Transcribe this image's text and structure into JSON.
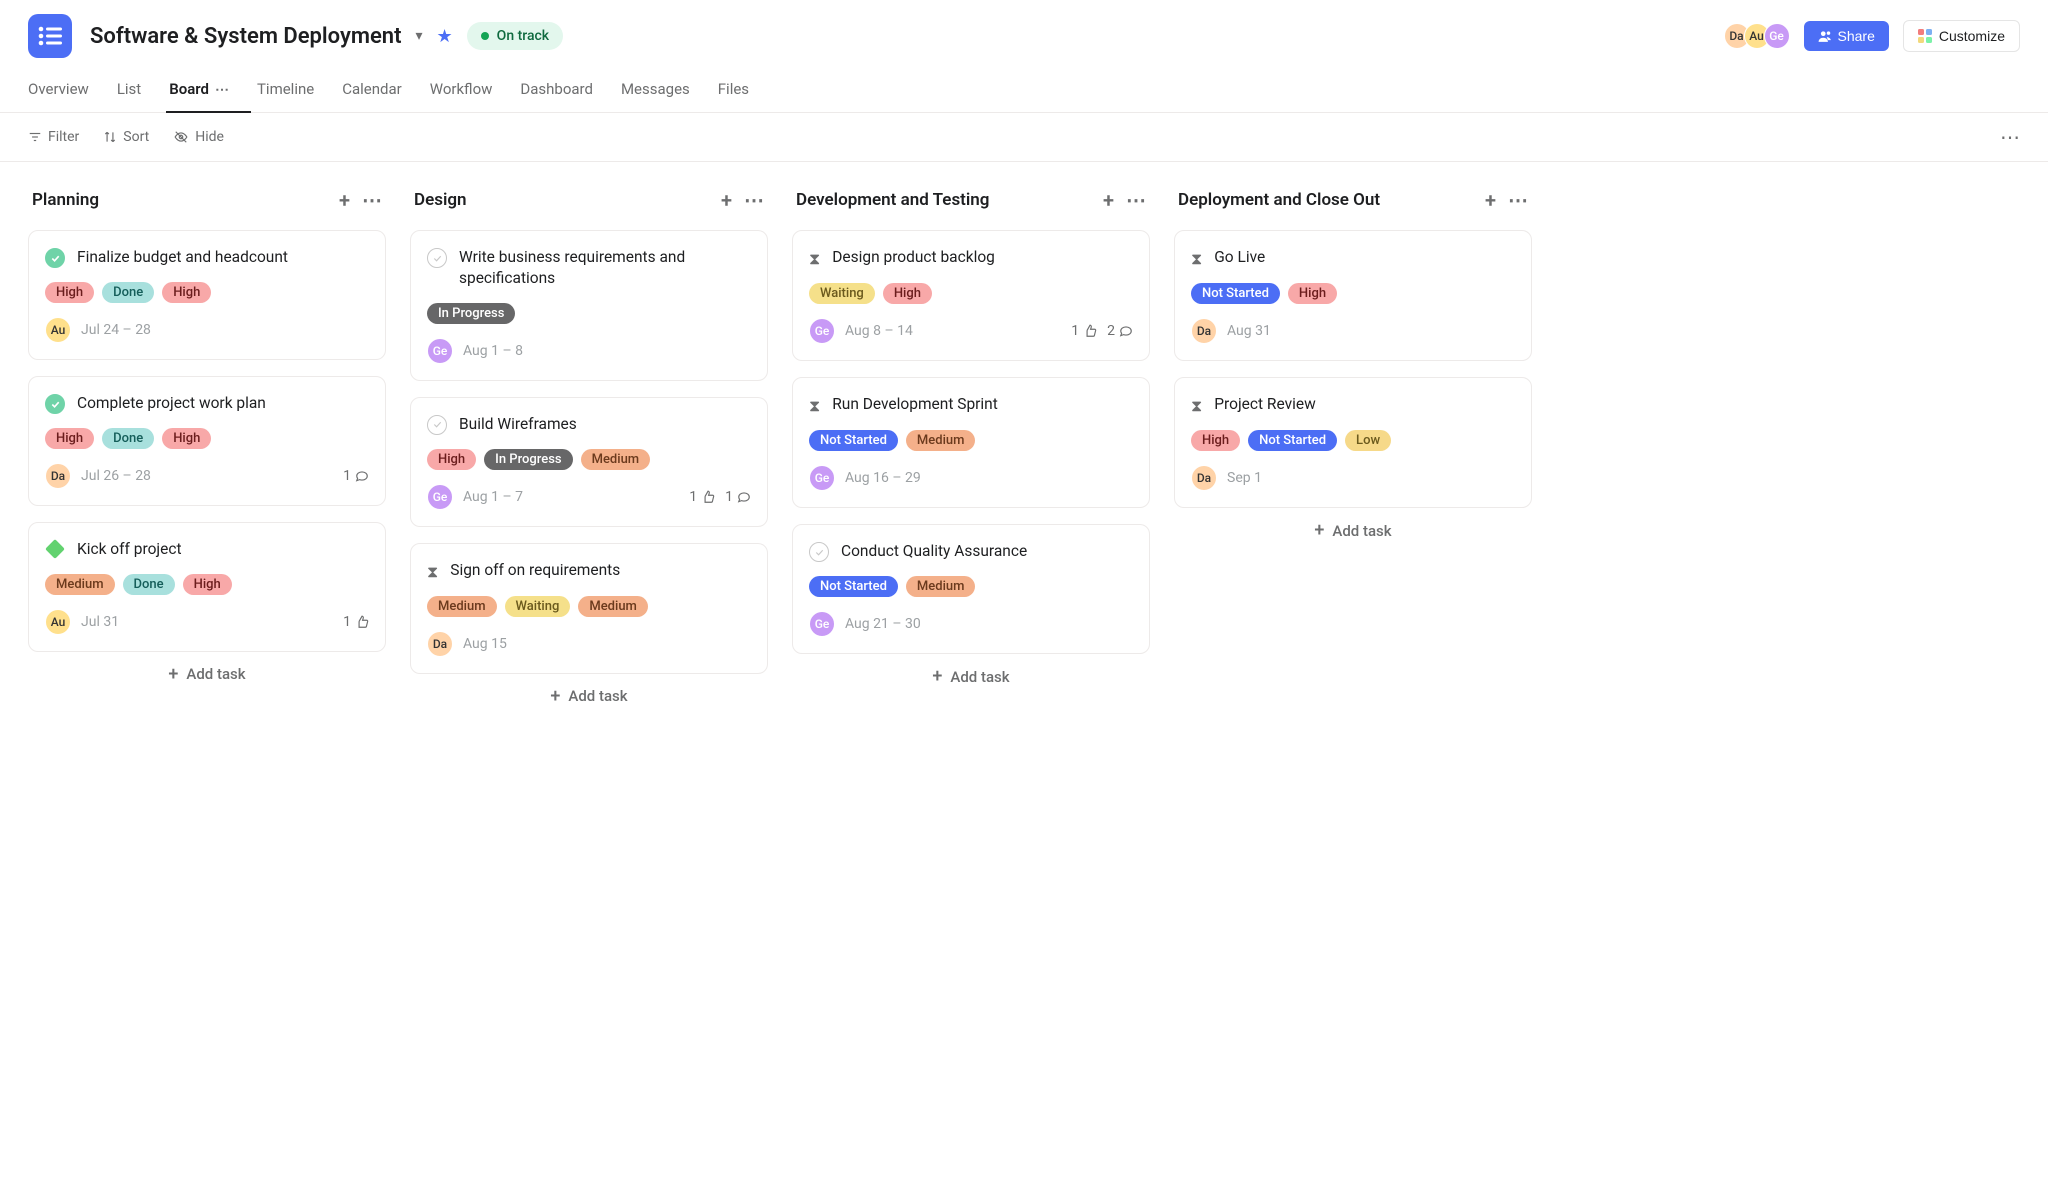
{
  "project": {
    "title": "Software & System Deployment",
    "status": "On track"
  },
  "header": {
    "share_label": "Share",
    "customize_label": "Customize",
    "members": [
      "Da",
      "Au",
      "Ge"
    ]
  },
  "tabs": [
    {
      "label": "Overview"
    },
    {
      "label": "List"
    },
    {
      "label": "Board",
      "active": true
    },
    {
      "label": "Timeline"
    },
    {
      "label": "Calendar"
    },
    {
      "label": "Workflow"
    },
    {
      "label": "Dashboard"
    },
    {
      "label": "Messages"
    },
    {
      "label": "Files"
    }
  ],
  "toolbar": {
    "filter": "Filter",
    "sort": "Sort",
    "hide": "Hide"
  },
  "add_task_label": "Add task",
  "columns": [
    {
      "title": "Planning",
      "cards": [
        {
          "icon": "check-done",
          "title": "Finalize budget and headcount",
          "tags": [
            "High",
            "Done",
            "High"
          ],
          "assignee": "Au",
          "date": "Jul 24 – 28"
        },
        {
          "icon": "check-done",
          "title": "Complete project work plan",
          "tags": [
            "High",
            "Done",
            "High"
          ],
          "assignee": "Da",
          "date": "Jul 26 – 28",
          "comments": 1
        },
        {
          "icon": "milestone",
          "title": "Kick off project",
          "tags": [
            "Medium",
            "Done",
            "High"
          ],
          "assignee": "Au",
          "date": "Jul 31",
          "likes": 1
        }
      ]
    },
    {
      "title": "Design",
      "cards": [
        {
          "icon": "check",
          "title": "Write business requirements and specifications",
          "tags": [
            "In Progress"
          ],
          "assignee": "Ge",
          "date": "Aug 1 – 8"
        },
        {
          "icon": "check",
          "title": "Build Wireframes",
          "tags": [
            "High",
            "In Progress",
            "Medium"
          ],
          "assignee": "Ge",
          "date": "Aug 1 – 7",
          "likes": 1,
          "comments": 1
        },
        {
          "icon": "hourglass",
          "title": "Sign off on requirements",
          "tags": [
            "Medium",
            "Waiting",
            "Medium"
          ],
          "assignee": "Da",
          "date": "Aug 15"
        }
      ]
    },
    {
      "title": "Development and Testing",
      "cards": [
        {
          "icon": "hourglass",
          "title": "Design product backlog",
          "tags": [
            "Waiting",
            "High"
          ],
          "assignee": "Ge",
          "date": "Aug 8 – 14",
          "likes": 1,
          "comments": 2
        },
        {
          "icon": "hourglass",
          "title": "Run Development Sprint",
          "tags": [
            "Not Started",
            "Medium"
          ],
          "assignee": "Ge",
          "date": "Aug 16 – 29"
        },
        {
          "icon": "check",
          "title": "Conduct Quality Assurance",
          "tags": [
            "Not Started",
            "Medium"
          ],
          "assignee": "Ge",
          "date": "Aug 21 – 30"
        }
      ]
    },
    {
      "title": "Deployment and Close Out",
      "cards": [
        {
          "icon": "hourglass",
          "title": "Go Live",
          "tags": [
            "Not Started",
            "High"
          ],
          "assignee": "Da",
          "date": "Aug 31"
        },
        {
          "icon": "hourglass",
          "title": "Project Review",
          "tags": [
            "High",
            "Not Started",
            "Low"
          ],
          "assignee": "Da",
          "date": "Sep 1"
        }
      ]
    }
  ]
}
